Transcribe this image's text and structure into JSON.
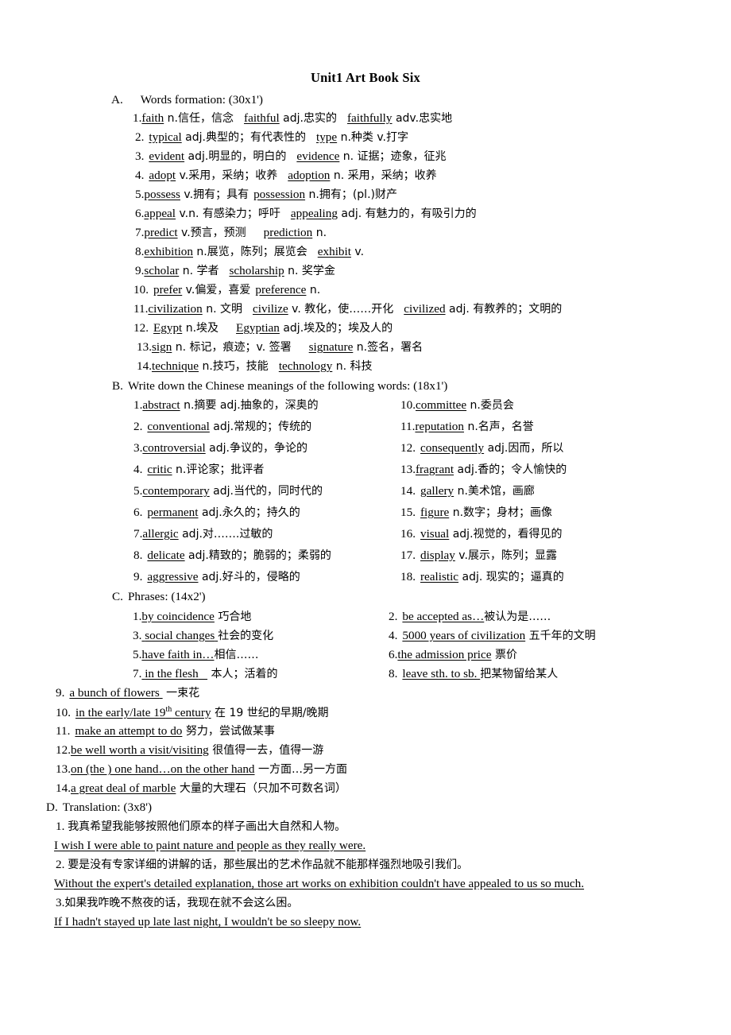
{
  "document": {
    "title": "Unit1 Art Book Six"
  },
  "sections": {
    "a": {
      "label": "A.",
      "heading": "Words formation: (30x1')",
      "items": [
        {
          "num": "1.",
          "w1": "faith",
          "t1": " n.信任，信念",
          "w2": "faithful",
          "t2": " adj.忠实的",
          "w3": "faithfully",
          "t3": " adv.忠实地"
        },
        {
          "num": "2.",
          "w1": "typical",
          "t1": " adj.典型的；有代表性的",
          "w2": "type",
          "t2": " n.种类    v.打字",
          "w3": "",
          "t3": ""
        },
        {
          "num": "3.",
          "w1": "evident",
          "t1": " adj.明显的，明白的",
          "w2": "evidence",
          "t2": " n. 证据；迹象，征兆",
          "w3": "",
          "t3": ""
        },
        {
          "num": "4.",
          "w1": "adopt",
          "t1": " v.采用，采纳；收养",
          "w2": "adoption",
          "t2": " n. 采用，采纳；收养",
          "w3": "",
          "t3": ""
        },
        {
          "num": "5.",
          "w1": "possess",
          "t1": " v.拥有；具有",
          "w2": "possession",
          "t2": " n.拥有；(pl.)财产",
          "w3": "",
          "t3": ""
        },
        {
          "num": "6.",
          "w1": "appeal",
          "t1": " v.n. 有感染力；呼吁",
          "w2": "appealing",
          "t2": " adj. 有魅力的，有吸引力的",
          "w3": "",
          "t3": ""
        },
        {
          "num": "7.",
          "w1": "predict",
          "t1": " v.预言，预测",
          "w2": "prediction",
          "t2": " n.",
          "w3": "",
          "t3": ""
        },
        {
          "num": "8.",
          "w1": "exhibition",
          "t1": " n.展览，陈列；展览会",
          "w2": "exhibit",
          "t2": " v.",
          "w3": "",
          "t3": ""
        },
        {
          "num": "9.",
          "w1": "scholar",
          "t1": " n. 学者",
          "w2": "scholarship",
          "t2": " n. 奖学金",
          "w3": "",
          "t3": ""
        },
        {
          "num": "10.",
          "w1": "prefer",
          "t1": " v.偏爱，喜爱",
          "w2": "preference",
          "t2": " n.",
          "w3": "",
          "t3": ""
        },
        {
          "num": "11.",
          "w1": "civilization",
          "t1": " n. 文明",
          "w2": "civilize",
          "t2": " v. 教化，使……开化",
          "w3": "civilized",
          "t3": " adj. 有教养的；文明的"
        },
        {
          "num": "12.",
          "w1": "Egypt",
          "t1": " n.埃及",
          "w2": "Egyptian",
          "t2": " adj.埃及的；埃及人的",
          "w3": "",
          "t3": ""
        },
        {
          "num": "13.",
          "w1": "sign",
          "t1": " n. 标记，痕迹；v. 签署",
          "w2": "signature",
          "t2": " n.签名，署名",
          "w3": "",
          "t3": ""
        },
        {
          "num": "14.",
          "w1": "technique",
          "t1": " n.技巧，技能",
          "w2": "technology",
          "t2": " n. 科技",
          "w3": "",
          "t3": ""
        }
      ]
    },
    "b": {
      "label": "B.",
      "heading": "Write down the Chinese meanings of the following words: (18x1')",
      "left_items": [
        {
          "num": "1.",
          "word": "abstract",
          "meaning": " n.摘要    adj.抽象的，深奥的"
        },
        {
          "num": "2.",
          "word": "conventional",
          "meaning": " adj.常规的；传统的"
        },
        {
          "num": "3.",
          "word": "controversial",
          "meaning": " adj.争议的，争论的"
        },
        {
          "num": "4.",
          "word": "critic",
          "meaning": " n.评论家；批评者"
        },
        {
          "num": "5.",
          "word": "contemporary",
          "meaning": " adj.当代的，同时代的"
        },
        {
          "num": "6.",
          "word": "permanent",
          "meaning": " adj.永久的；持久的"
        },
        {
          "num": "7.",
          "word": "allergic",
          "meaning": " adj.对…….过敏的"
        },
        {
          "num": "8.",
          "word": "delicate",
          "meaning": " adj.精致的；脆弱的；柔弱的"
        },
        {
          "num": "9.",
          "word": "aggressive",
          "meaning": " adj.好斗的，侵略的"
        }
      ],
      "right_items": [
        {
          "num": "10.",
          "word": "committee",
          "meaning": " n.委员会"
        },
        {
          "num": "11.",
          "word": "reputation",
          "meaning": " n.名声，名誉"
        },
        {
          "num": "12.",
          "word": "consequently",
          "meaning": " adj.因而，所以"
        },
        {
          "num": "13.",
          "word": "fragrant",
          "meaning": " adj.香的；令人愉快的"
        },
        {
          "num": "14.",
          "word": "gallery",
          "meaning": " n.美术馆，画廊"
        },
        {
          "num": "15.",
          "word": "figure",
          "meaning": " n.数字；身材；画像"
        },
        {
          "num": "16.",
          "word": "visual",
          "meaning": " adj.视觉的，看得见的"
        },
        {
          "num": "17.",
          "word": "display",
          "meaning": " v.展示，陈列；显露"
        },
        {
          "num": "18.",
          "word": "realistic",
          "meaning": " adj. 现实的；逼真的"
        }
      ]
    },
    "c": {
      "label": "C.",
      "heading": "Phrases: (14x2')",
      "left_items": [
        {
          "num": "1.",
          "phrase": "by coincidence",
          "meaning": " 巧合地"
        },
        {
          "num": "3.",
          "phrase": "social changes",
          "meaning": "社会的变化"
        },
        {
          "num": "5.",
          "phrase": "have faith in…",
          "meaning": "相信……"
        },
        {
          "num": "7.",
          "phrase": "in the flesh",
          "meaning": " 本人；活着的"
        }
      ],
      "right_items": [
        {
          "num": "2.",
          "phrase": "be accepted as…",
          "meaning": "被认为是……"
        },
        {
          "num": "4.",
          "phrase": "5000 years of civilization",
          "meaning": " 五千年的文明"
        },
        {
          "num": "6.",
          "phrase": "the admission price",
          "meaning": " 票价"
        },
        {
          "num": "8.",
          "phrase": "leave sth. to sb.",
          "meaning": "把某物留给某人"
        }
      ],
      "wide_items": [
        {
          "num": "9.",
          "phrase": "a bunch of flowers",
          "meaning": " 一束花"
        },
        {
          "num": "10.",
          "phrase_pre": "in the early/late 19",
          "sup": "th",
          "phrase_post": " century",
          "meaning": " 在 19 世纪的早期/晚期"
        },
        {
          "num": "11.",
          "phrase": "make an attempt to do",
          "meaning": " 努力，尝试做某事"
        },
        {
          "num": "12.",
          "phrase": "be well worth a visit/visiting",
          "meaning": " 很值得一去，值得一游"
        },
        {
          "num": "13.",
          "phrase": "on (the ) one hand…on the other hand",
          "meaning": " 一方面…另一方面"
        },
        {
          "num": "14.",
          "phrase": "a great deal of marble",
          "meaning": " 大量的大理石（只加不可数名词）"
        }
      ]
    },
    "d": {
      "label": "D.",
      "heading": "Translation: (3x8')",
      "items": [
        {
          "num": "1. ",
          "chinese": "我真希望我能够按照他们原本的样子画出大自然和人物。",
          "english": "I wish I were able to paint nature and people as they really were."
        },
        {
          "num": "2. ",
          "chinese": "要是没有专家详细的讲解的话，那些展出的艺术作品就不能那样强烈地吸引我们。",
          "english": "Without the expert's detailed explanation, those art works on exhibition couldn't have appealed to us so much."
        },
        {
          "num": "3.",
          "chinese": "如果我咋晚不熬夜的话，我现在就不会这么困。",
          "english": "If I hadn't stayed up late last night, I wouldn't be so sleepy now."
        }
      ]
    }
  }
}
